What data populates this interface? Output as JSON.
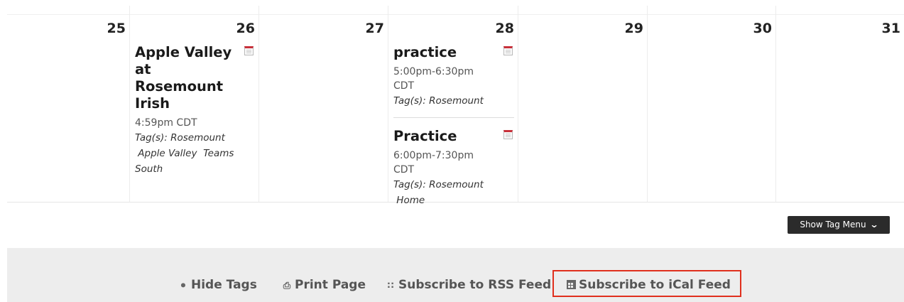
{
  "calendar": {
    "days": [
      {
        "number": "25",
        "events": []
      },
      {
        "number": "26",
        "events": [
          {
            "title": "Apple Valley at Rosemount Irish",
            "time": "4:59pm CDT",
            "tags_prefix": "Tag(s):",
            "tags": [
              "Rosemount",
              "Apple Valley",
              "Teams",
              "South"
            ]
          }
        ]
      },
      {
        "number": "27",
        "events": []
      },
      {
        "number": "28",
        "events": [
          {
            "title": "practice",
            "time": "5:00pm-6:30pm CDT",
            "tags_prefix": "Tag(s):",
            "tags": [
              "Rosemount"
            ]
          },
          {
            "title": "Practice",
            "time": "6:00pm-7:30pm CDT",
            "tags_prefix": "Tag(s):",
            "tags": [
              "Rosemount",
              "Home"
            ]
          }
        ]
      },
      {
        "number": "29",
        "events": []
      },
      {
        "number": "30",
        "events": []
      },
      {
        "number": "31",
        "events": []
      }
    ],
    "ical_icon": "ical-export-icon"
  },
  "tag_menu_button": {
    "label": "Show Tag Menu",
    "icon": "chevron-down-icon"
  },
  "footer": {
    "hide_tags": {
      "label": "Hide Tags",
      "icon": "tag-icon"
    },
    "print_page": {
      "label": "Print Page",
      "icon": "print-icon"
    },
    "rss": {
      "label": "Subscribe to RSS Feed",
      "icon": "rss-icon"
    },
    "ical": {
      "label": "Subscribe to iCal Feed",
      "icon": "calendar-icon",
      "highlight_color": "#e0301e"
    }
  }
}
